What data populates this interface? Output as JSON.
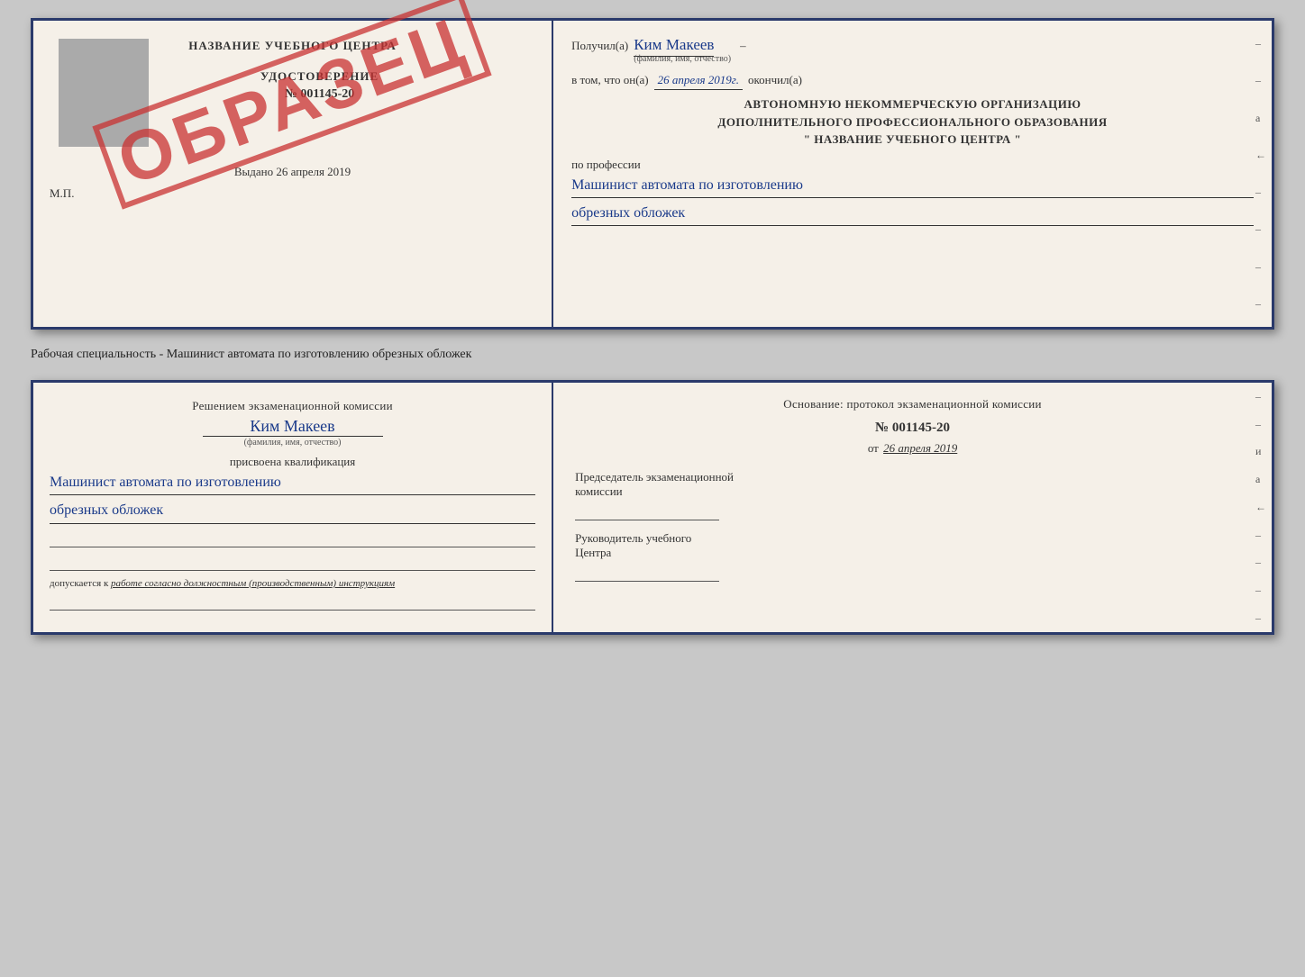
{
  "top_doc": {
    "left": {
      "edu_center": "НАЗВАНИЕ УЧЕБНОГО ЦЕНТРА",
      "cert_label": "УДОСТОВЕРЕНИЕ",
      "cert_number": "№ 001145-20",
      "stamp_text": "ОБРАЗЕЦ",
      "vydano_prefix": "Выдано",
      "vydano_date": "26 апреля 2019",
      "mp_label": "М.П.",
      "gray_box_alt": "фото"
    },
    "right": {
      "poluchil_prefix": "Получил(а)",
      "recipient_name": "Ким Макеев",
      "fio_label": "(фамилия, имя, отчество)",
      "vtom_prefix": "в том, что он(а)",
      "completed_date": "26 апреля 2019г.",
      "okonchil": "окончил(а)",
      "org_line1": "АВТОНОМНУЮ НЕКОММЕРЧЕСКУЮ ОРГАНИЗАЦИЮ",
      "org_line2": "ДОПОЛНИТЕЛЬНОГО ПРОФЕССИОНАЛЬНОГО ОБРАЗОВАНИЯ",
      "org_line3": "\" НАЗВАНИЕ УЧЕБНОГО ЦЕНТРА \"",
      "po_professii": "по профессии",
      "profession_line1": "Машинист автомата по изготовлению",
      "profession_line2": "обрезных обложек",
      "side_chars": [
        "–",
        "–",
        "а",
        "←",
        "–",
        "–",
        "–",
        "–"
      ]
    }
  },
  "caption": "Рабочая специальность - Машинист автомата по изготовлению обрезных обложек",
  "bottom_doc": {
    "left": {
      "resheniem": "Решением экзаменационной комиссии",
      "recipient_name": "Ким Макеев",
      "fio_label": "(фамилия, имя, отчество)",
      "prisvoyena": "присвоена квалификация",
      "qual_line1": "Машинист автомата по изготовлению",
      "qual_line2": "обрезных обложек",
      "dopusk_text": "допускается к",
      "dopusk_italic": "работе согласно должностным (производственным) инструкциям"
    },
    "right": {
      "osnovanie": "Основание: протокол экзаменационной комиссии",
      "protocol_number": "№ 001145-20",
      "ot_prefix": "от",
      "ot_date": "26 апреля 2019",
      "predsedatel_line1": "Председатель экзаменационной",
      "predsedatel_line2": "комиссии",
      "rukovoditel_line1": "Руководитель учебного",
      "rukovoditel_line2": "Центра",
      "side_chars": [
        "–",
        "–",
        "и",
        "а",
        "←",
        "–",
        "–",
        "–",
        "–"
      ]
    }
  }
}
